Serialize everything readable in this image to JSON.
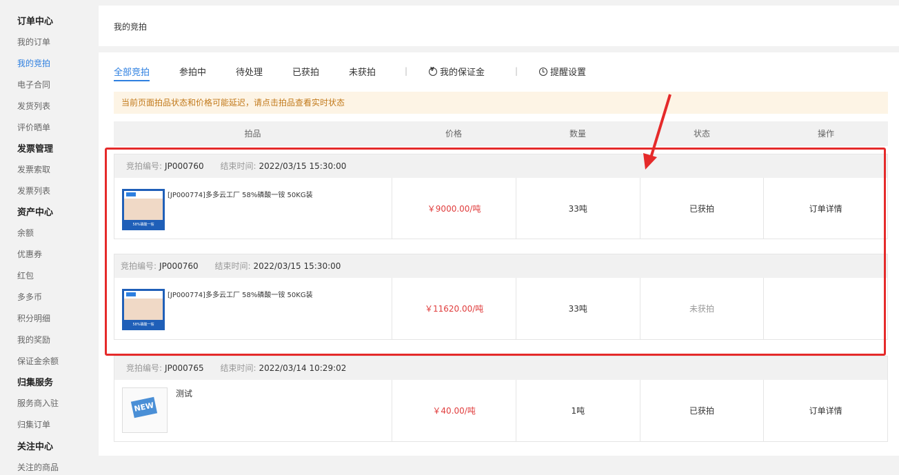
{
  "sidebar": {
    "groups": [
      {
        "title": "订单中心",
        "items": [
          "我的订单",
          "我的竞拍",
          "电子合同",
          "发货列表",
          "评价晒单"
        ]
      },
      {
        "title": "发票管理",
        "items": [
          "发票索取",
          "发票列表"
        ]
      },
      {
        "title": "资产中心",
        "items": [
          "余额",
          "优惠券",
          "红包",
          "多多币",
          "积分明细",
          "我的奖励",
          "保证金余额"
        ]
      },
      {
        "title": "归集服务",
        "items": [
          "服务商入驻",
          "归集订单"
        ]
      },
      {
        "title": "关注中心",
        "items": [
          "关注的商品"
        ]
      }
    ],
    "active_item": "我的竞拍"
  },
  "header": {
    "title": "我的竞拍"
  },
  "tabs": [
    "全部竞拍",
    "参拍中",
    "待处理",
    "已获拍",
    "未获拍"
  ],
  "tab_links": [
    {
      "label": "我的保证金",
      "icon": "coin-icon"
    },
    {
      "label": "提醒设置",
      "icon": "clock-icon"
    }
  ],
  "notice": "当前页面拍品状态和价格可能延迟，请点击拍品查看实时状态",
  "table": {
    "columns": [
      "拍品",
      "价格",
      "数量",
      "状态",
      "操作"
    ],
    "id_label": "竞拍编号:",
    "end_label": "结束时间:",
    "rows": [
      {
        "id": "JP000760",
        "end_time": "2022/03/15 15:30:00",
        "product": "[JP000774]多多云工厂 58%磷酸一铵 50KG装",
        "price": "￥9000.00/吨",
        "qty": "33吨",
        "status": "已获拍",
        "action": "订单详情"
      },
      {
        "id": "JP000760",
        "end_time": "2022/03/15 15:30:00",
        "product": "[JP000774]多多云工厂 58%磷酸一铵 50KG装",
        "price": "￥11620.00/吨",
        "qty": "33吨",
        "status": "未获拍",
        "action": ""
      },
      {
        "id": "JP000765",
        "end_time": "2022/03/14 10:29:02",
        "product": "测试",
        "price": "￥40.00/吨",
        "qty": "1吨",
        "status": "已获拍",
        "action": "订单详情"
      }
    ]
  },
  "thumb_badge": "58%磷酸一铵",
  "thumb_sign": "NEW",
  "colors": {
    "accent": "#2d7fe0",
    "price": "#e03c3c",
    "annotation": "#e52a2a",
    "notice_bg": "#fdf4e5",
    "notice_text": "#c27a1c"
  }
}
